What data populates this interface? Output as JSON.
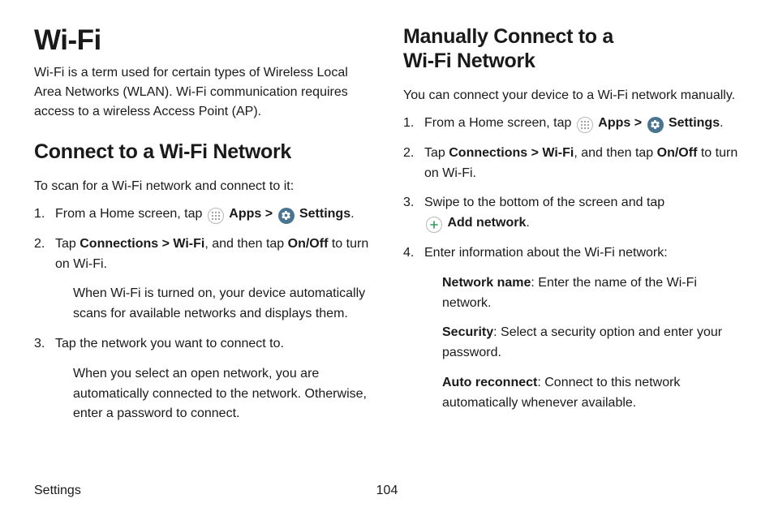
{
  "left": {
    "title": "Wi-Fi",
    "intro": "Wi-Fi is a term used for certain types of Wireless Local Area Networks (WLAN). Wi-Fi communication requires access to a wireless Access Point (AP).",
    "h2": "Connect to a Wi-Fi Network",
    "lead": "To scan for a Wi-Fi network and connect to it:",
    "step1_pre": "From a Home screen, tap ",
    "apps_label": "Apps",
    "caret": " > ",
    "settings_label": "Settings",
    "step1_post": ".",
    "step2_pre": "Tap ",
    "conn": "Connections",
    "wifi": "Wi-Fi",
    "step2_mid": ", and then tap ",
    "onoff": "On/Off",
    "step2_post": " to turn on Wi-Fi.",
    "step2_sub": "When Wi-Fi is turned on, your device automatically scans for available networks and displays them.",
    "step3": "Tap the network you want to connect to.",
    "step3_sub": "When you select an open network, you are automatically connected to the network. Otherwise, enter a password to connect."
  },
  "right": {
    "h2a": "Manually Connect to a",
    "h2b": "Wi-Fi Network",
    "lead": "You can connect your device to a Wi-Fi network manually.",
    "step1_pre": "From a Home screen, tap ",
    "apps_label": "Apps",
    "caret": " > ",
    "settings_label": "Settings",
    "step1_post": ".",
    "step2_pre": "Tap ",
    "conn": "Connections",
    "wifi": "Wi-Fi",
    "step2_mid": ", and then tap ",
    "onoff": "On/Off",
    "step2_post": " to turn on Wi-Fi.",
    "step3_pre": "Swipe to the bottom of the screen and tap ",
    "addnet": "Add network",
    "step3_post": ".",
    "step4": "Enter information about the Wi-Fi network:",
    "sub1_b": "Network name",
    "sub1": ": Enter the name of the Wi-Fi network.",
    "sub2_b": "Security",
    "sub2": ": Select a security option and enter your password.",
    "sub3_b": "Auto reconnect",
    "sub3": ": Connect to this network automatically whenever available."
  },
  "footer": {
    "section": "Settings",
    "page": "104"
  }
}
